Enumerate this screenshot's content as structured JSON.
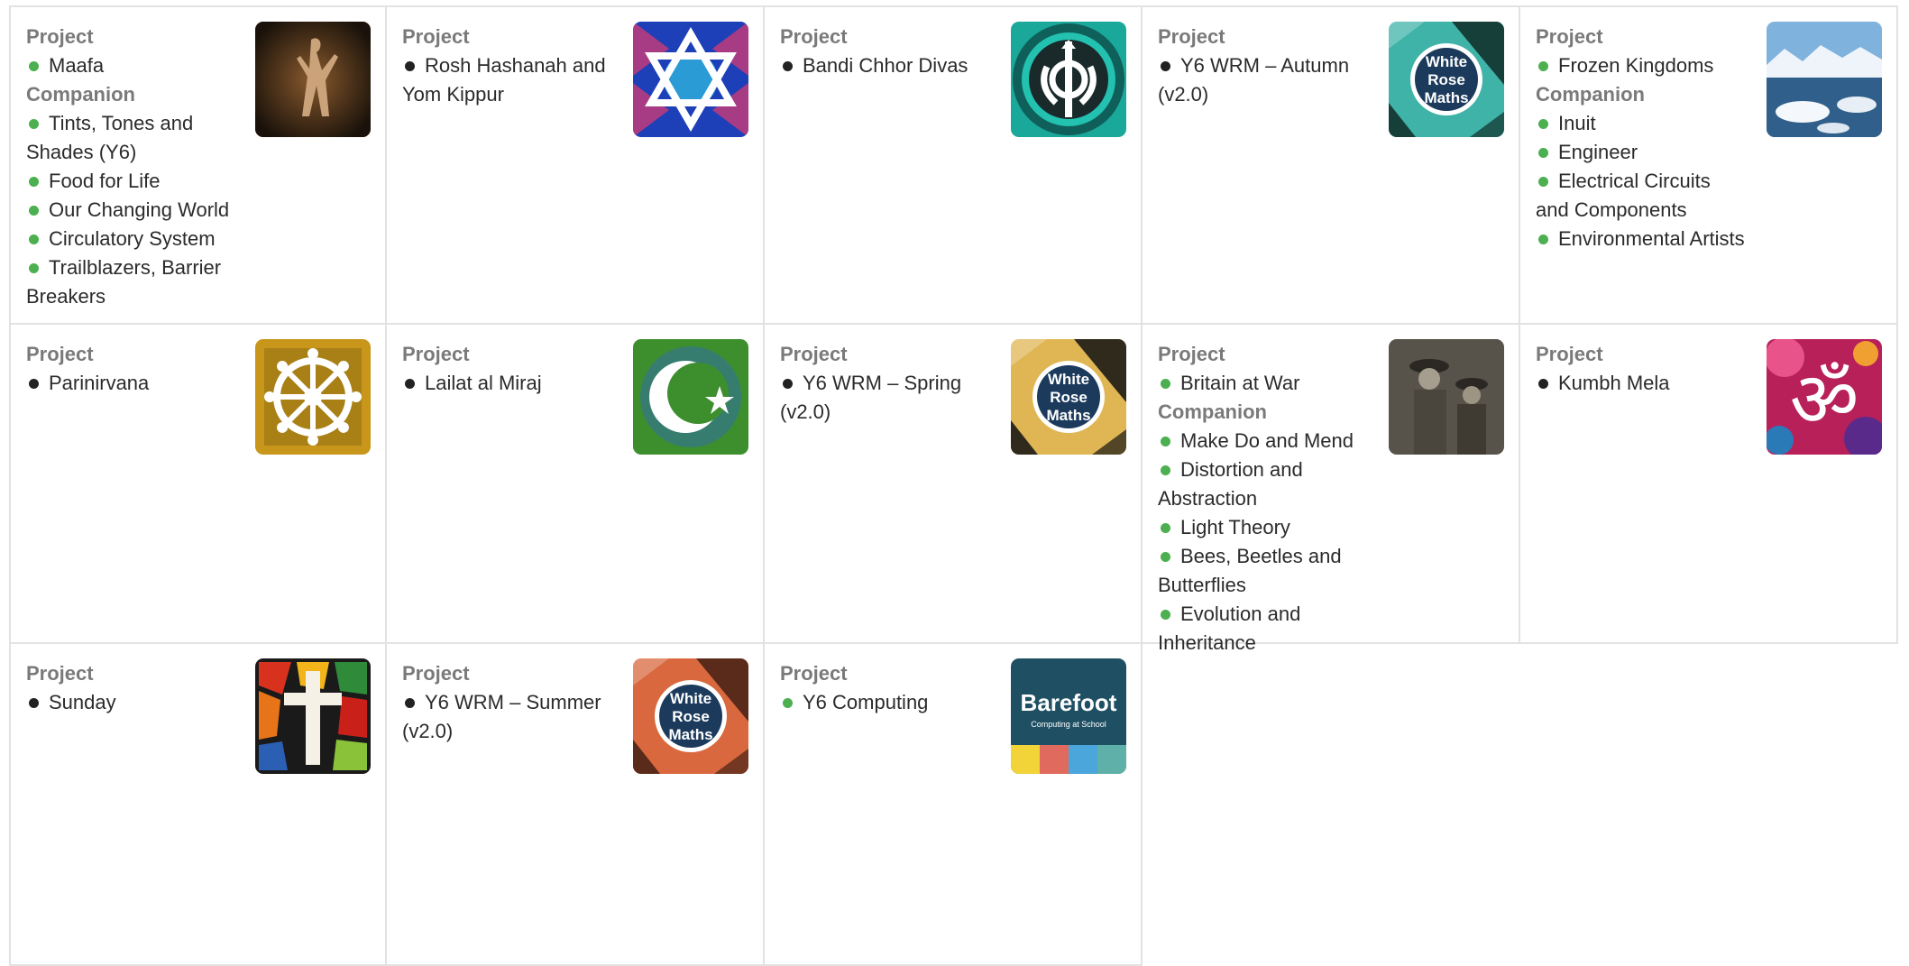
{
  "labels": {
    "project": "Project",
    "companion": "Companion"
  },
  "cards": [
    {
      "project": [
        {
          "text": "Maafa",
          "dot": "green"
        }
      ],
      "companion": [
        {
          "text": "Tints, Tones and Shades (Y6)",
          "dot": "green"
        },
        {
          "text": "Food for Life",
          "dot": "green"
        },
        {
          "text": "Our Changing World",
          "dot": "green"
        },
        {
          "text": "Circulatory System",
          "dot": "green"
        },
        {
          "text": "Trailblazers, Barrier Breakers",
          "dot": "green"
        }
      ],
      "icon": "dancer-photo-icon"
    },
    {
      "project": [
        {
          "text": "Rosh Hashanah and Yom Kippur",
          "dot": "black"
        }
      ],
      "icon": "star-of-david-icon"
    },
    {
      "project": [
        {
          "text": "Bandi Chhor Divas",
          "dot": "black"
        }
      ],
      "icon": "khanda-icon"
    },
    {
      "project": [
        {
          "text": "Y6 WRM – Autumn (v2.0)",
          "dot": "black"
        }
      ],
      "icon": "white-rose-maths-logo",
      "logo_colors": [
        "#3fb3a8",
        "#173f3a"
      ]
    },
    {
      "project": [
        {
          "text": "Frozen Kingdoms",
          "dot": "green"
        }
      ],
      "companion": [
        {
          "text": "Inuit",
          "dot": "green"
        },
        {
          "text": "Engineer",
          "dot": "green"
        },
        {
          "text": "Electrical Circuits and Components",
          "dot": "green"
        },
        {
          "text": "Environmental Artists",
          "dot": "green"
        }
      ],
      "icon": "arctic-photo-icon"
    },
    {
      "project": [
        {
          "text": "Parinirvana",
          "dot": "black"
        }
      ],
      "icon": "dharma-wheel-icon"
    },
    {
      "project": [
        {
          "text": "Lailat al Miraj",
          "dot": "black"
        }
      ],
      "icon": "crescent-star-icon"
    },
    {
      "project": [
        {
          "text": "Y6 WRM – Spring (v2.0)",
          "dot": "black"
        }
      ],
      "icon": "white-rose-maths-logo",
      "logo_colors": [
        "#e0b654",
        "#2f2a1c"
      ]
    },
    {
      "project": [
        {
          "text": "Britain at War",
          "dot": "green"
        }
      ],
      "companion": [
        {
          "text": "Make Do and Mend",
          "dot": "green"
        },
        {
          "text": "Distortion and Abstraction",
          "dot": "green"
        },
        {
          "text": "Light Theory",
          "dot": "green"
        },
        {
          "text": "Bees, Beetles and Butterflies",
          "dot": "green"
        },
        {
          "text": "Evolution and Inheritance",
          "dot": "green"
        }
      ],
      "icon": "soldiers-photo-icon"
    },
    {
      "project": [
        {
          "text": "Kumbh Mela",
          "dot": "black"
        }
      ],
      "icon": "om-icon"
    },
    {
      "project": [
        {
          "text": "Sunday",
          "dot": "black"
        }
      ],
      "icon": "stained-glass-cross-icon"
    },
    {
      "project": [
        {
          "text": "Y6 WRM – Summer (v2.0)",
          "dot": "black"
        }
      ],
      "icon": "white-rose-maths-logo",
      "logo_colors": [
        "#d9683e",
        "#5a2a1a"
      ]
    },
    {
      "project": [
        {
          "text": "Y6 Computing",
          "dot": "green"
        }
      ],
      "icon": "barefoot-logo"
    }
  ],
  "logos": {
    "wrm": [
      "White",
      "Rose",
      "Maths"
    ],
    "barefoot": {
      "title": "Barefoot",
      "subtitle": "Computing at School"
    }
  },
  "colors": {
    "green_dot": "#4caf50",
    "black_dot": "#222222",
    "label_gray": "#7a7a7a",
    "border": "#e2e2e2"
  }
}
